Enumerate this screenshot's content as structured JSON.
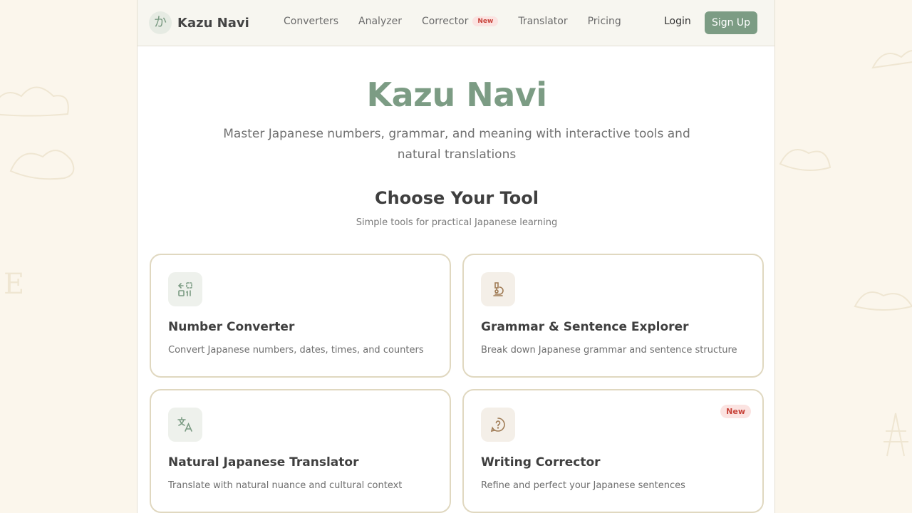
{
  "brand": {
    "logo_glyph": "か",
    "name": "Kazu Navi"
  },
  "nav": {
    "items": [
      {
        "label": "Converters"
      },
      {
        "label": "Analyzer"
      },
      {
        "label": "Corrector",
        "badge": "New"
      },
      {
        "label": "Translator"
      },
      {
        "label": "Pricing"
      }
    ],
    "login": "Login",
    "signup": "Sign Up"
  },
  "hero": {
    "title": "Kazu Navi",
    "subtitle": "Master Japanese numbers, grammar, and meaning with interactive tools and natural translations"
  },
  "tools": {
    "title": "Choose Your Tool",
    "subtitle": "Simple tools for practical Japanese learning",
    "cards": [
      {
        "title": "Number Converter",
        "desc": "Convert Japanese numbers, dates, times, and counters",
        "icon": "number-convert-icon"
      },
      {
        "title": "Grammar & Sentence Explorer",
        "desc": "Break down Japanese grammar and sentence structure",
        "icon": "microscope-icon"
      },
      {
        "title": "Natural Japanese Translator",
        "desc": "Translate with natural nuance and cultural context",
        "icon": "translate-icon"
      },
      {
        "title": "Writing Corrector",
        "desc": "Refine and perfect your Japanese sentences",
        "icon": "question-bubble-icon",
        "badge": "New"
      }
    ]
  },
  "colors": {
    "accent": "#7c9c84",
    "background": "#fbf6ec",
    "badge_bg": "#fbe3e1",
    "badge_text": "#c8443b",
    "card_border": "#e0d8c0"
  }
}
